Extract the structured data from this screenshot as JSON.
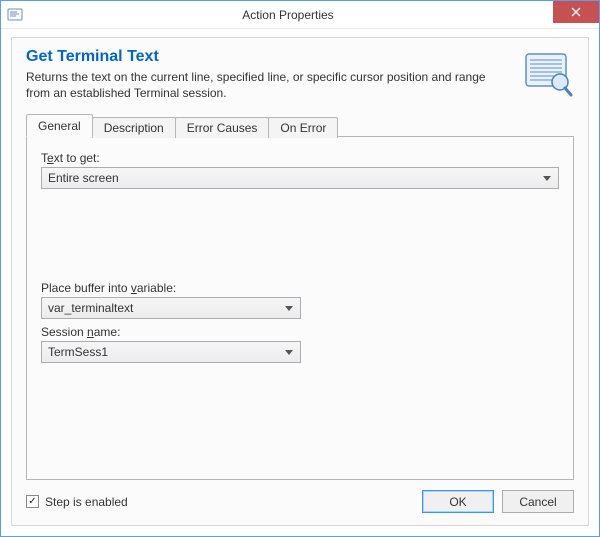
{
  "window": {
    "title": "Action Properties"
  },
  "header": {
    "title": "Get Terminal Text",
    "description": "Returns the text on the current line, specified line, or specific cursor position and range from an established Terminal session."
  },
  "tabs": [
    {
      "label": "General",
      "active": true
    },
    {
      "label": "Description",
      "active": false
    },
    {
      "label": "Error Causes",
      "active": false
    },
    {
      "label": "On Error",
      "active": false
    }
  ],
  "fields": {
    "text_to_get": {
      "label_pre": "T",
      "label_u": "e",
      "label_post": "xt to get:",
      "value": "Entire screen"
    },
    "buffer_var": {
      "label_pre": "Place buffer into ",
      "label_u": "v",
      "label_post": "ariable:",
      "value": "var_terminaltext"
    },
    "session_name": {
      "label_pre": "Session ",
      "label_u": "n",
      "label_post": "ame:",
      "value": "TermSess1"
    }
  },
  "footer": {
    "step_enabled_label": "Step is enabled",
    "step_enabled_checked": true,
    "ok": "OK",
    "cancel": "Cancel"
  }
}
